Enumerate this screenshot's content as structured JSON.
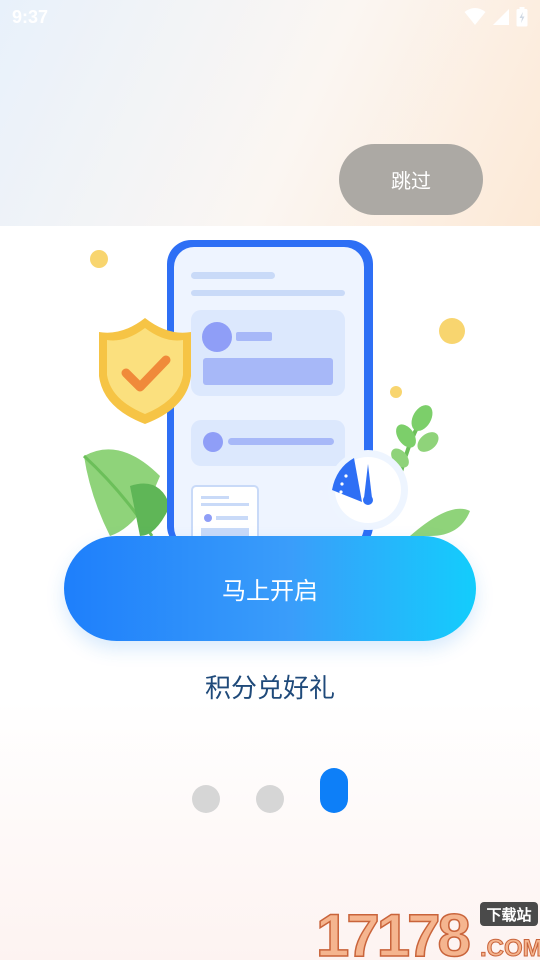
{
  "status_bar": {
    "time": "9:37",
    "icons": [
      "wifi-icon",
      "cellular-signal-icon",
      "battery-icon"
    ]
  },
  "skip": {
    "label": "跳过"
  },
  "illustration": {
    "elements": [
      "phone-mockup",
      "shield-check-icon",
      "gauge-icon",
      "leaf-decoration"
    ]
  },
  "cta": {
    "label": "马上开启"
  },
  "subtitle": "积分兑好礼",
  "pager": {
    "total": 3,
    "current": 3
  },
  "watermark": {
    "number": "17178",
    "badge": "下载站",
    "suffix": ".COM"
  },
  "colors": {
    "accent": "#0d7ff8",
    "cta_start": "#1e7ffb",
    "cta_end": "#13cdfc",
    "skip_bg": "#aca9a4",
    "subtitle": "#1f4a7a"
  }
}
